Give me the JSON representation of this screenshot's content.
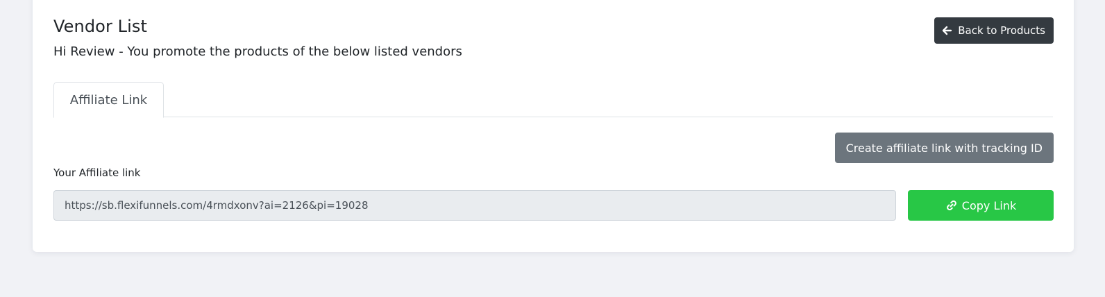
{
  "header": {
    "title": "Vendor List",
    "subtitle": "Hi Review - You promote the products of the below listed vendors",
    "back_button": {
      "label": "Back to Products",
      "icon": "arrow-left-icon"
    }
  },
  "tabs": [
    {
      "label": "Affiliate Link",
      "active": true
    }
  ],
  "affiliate": {
    "create_button_label": "Create affiliate link with tracking ID",
    "field_label": "Your Affiliate link",
    "link_value": "https://sb.flexifunnels.com/4rmdxonv?ai=2126&pi=19028",
    "copy_button": {
      "label": "Copy Link",
      "icon": "link-icon"
    }
  },
  "colors": {
    "page_background": "#f1f2f6",
    "back_button": "#343a40",
    "create_button": "#6c757d",
    "copy_button": "#28c746",
    "input_background": "#e9ecef"
  }
}
